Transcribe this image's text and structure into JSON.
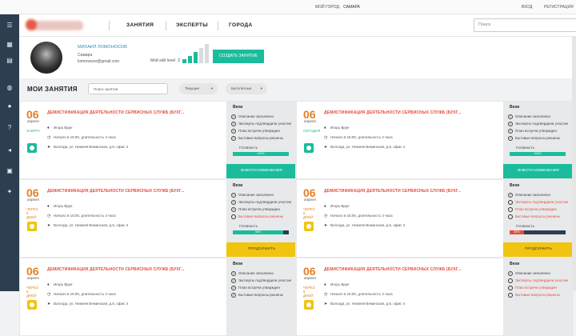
{
  "top": {
    "city_label": "МОЙ ГОРОД:",
    "city": "САМАРА",
    "login": "ВХОД",
    "register": "РЕГИСТРАЦИЯ"
  },
  "nav": {
    "items": [
      "ЗАНЯТИЯ",
      "ЭКСПЕРТЫ",
      "ГОРОДА"
    ],
    "search_placeholder": "Поиск",
    "search_icon": "search-icon"
  },
  "sidebar": {
    "icons": [
      "menu-icon",
      "home-icon",
      "calendar-icon",
      "globe-icon",
      "users-icon",
      "question-icon",
      "megaphone-icon",
      "briefcase-icon",
      "team-icon"
    ]
  },
  "profile": {
    "name": "МИХАИЛ ЛОМОНОСОВ",
    "city": "Самара",
    "email": "lomonosov@gmail.com",
    "skill_label": "Мой skill level",
    "skill_value": "3",
    "skill_level_fraction": 0.6,
    "create_button": "СОЗДАТЬ ЗАНЯТИЕ"
  },
  "toolbar": {
    "title": "МОИ ЗАНЯТИЯ",
    "search_placeholder": "Поиск занятия",
    "filter1": "Текущие",
    "filter2": "Бесплатные"
  },
  "cards": [
    {
      "day": "06",
      "month": "апреля",
      "when": "завтра",
      "title": "ДЕМИСТИФИКАЦИЯ ДЕЯТЕЛЬНОСТИ СЕРВИСНЫХ СЛУЖБ (БУХГ...",
      "person": "Игорь Вруе",
      "time": "Начало в 15:00, длительность 4 часа",
      "address": "Вологда, ул. Нижняя Вежинская, д.6, офис 4",
      "panel_title": "Вехи",
      "checks": [
        {
          "t": "Описание заполнено",
          "ok": true
        },
        {
          "t": "Эксперты подтвердили участие",
          "ok": true
        },
        {
          "t": "План встречи утвержден",
          "ok": true
        },
        {
          "t": "Бытовые вопросы решены",
          "ok": true
        }
      ],
      "ready_label": "Готовность",
      "progress_label": "100%",
      "progress": 100,
      "button": "ВНЕСТИ ИЗМЕНЕНИЯ",
      "status": "teal"
    },
    {
      "day": "06",
      "month": "апреля",
      "when": "сегодня",
      "title": "ДЕМИСТИФИКАЦИЯ ДЕЯТЕЛЬНОСТИ СЕРВИСНЫХ СЛУЖБ (БУХГ...",
      "person": "Игорь Вруе",
      "time": "Начало в 15:00, длительность 4 часа",
      "address": "Вологда, ул. Нижняя Вежинская, д.6, офис 4",
      "panel_title": "Вехи",
      "checks": [
        {
          "t": "Описание заполнено",
          "ok": true
        },
        {
          "t": "Эксперты подтвердили участие",
          "ok": true
        },
        {
          "t": "План встречи утвержден",
          "ok": true
        },
        {
          "t": "Бытовые вопросы решены",
          "ok": true
        }
      ],
      "ready_label": "Готовность",
      "progress_label": "100%",
      "progress": 100,
      "button": "ВНЕСТИ ИЗМЕНЕНИЯ",
      "status": "teal"
    },
    {
      "day": "06",
      "month": "апреля",
      "when": "через 5 дней",
      "title": "ДЕМИСТИФИКАЦИЯ ДЕЯТЕЛЬНОСТИ СЕРВИСНЫХ СЛУЖБ (БУХГ...",
      "person": "Игорь Вруе",
      "time": "Начало в 15:00, длительность 4 часа",
      "address": "Вологда, ул. Нижняя Вежинская, д.6, офис 4",
      "panel_title": "Вехи",
      "checks": [
        {
          "t": "Описание заполнено",
          "ok": true
        },
        {
          "t": "Эксперты подтвердили участие",
          "ok": true
        },
        {
          "t": "План встречи утвержден",
          "ok": true
        },
        {
          "t": "Бытовые вопросы решены",
          "ok": false
        }
      ],
      "ready_label": "Готовность",
      "progress_label": "90%",
      "progress": 90,
      "button": "ПРОДОЛЖИТЬ",
      "status": "yel"
    },
    {
      "day": "06",
      "month": "апреля",
      "when": "через 5 дней",
      "title": "ДЕМИСТИФИКАЦИЯ ДЕЯТЕЛЬНОСТИ СЕРВИСНЫХ СЛУЖБ (БУХГ...",
      "person": "Игорь Вруе",
      "time": "Начало в 15:00, длительность 4 часа",
      "address": "Вологда, ул. Нижняя Вежинская, д.6, офис 4",
      "panel_title": "Вехи",
      "checks": [
        {
          "t": "Описание заполнено",
          "ok": true
        },
        {
          "t": "Эксперты подтвердили участие",
          "ok": false
        },
        {
          "t": "План встречи утвержден",
          "ok": false
        },
        {
          "t": "Бытовые вопросы решены",
          "ok": false
        }
      ],
      "ready_label": "Готовность",
      "progress_label": "25%",
      "progress": 25,
      "button": "ПРОДОЛЖИТЬ",
      "status": "yel"
    },
    {
      "day": "06",
      "month": "апреля",
      "when": "через 5 дней",
      "title": "ДЕМИСТИФИКАЦИЯ ДЕЯТЕЛЬНОСТИ СЕРВИСНЫХ СЛУЖБ (БУХГ...",
      "person": "Игорь Вруе",
      "time": "Начало в 15:00, длительность 4 часа",
      "address": "Вологда, ул. Нижняя Вежинская, д.6, офис 4",
      "panel_title": "Вехи",
      "checks": [
        {
          "t": "Описание заполнено",
          "ok": true
        },
        {
          "t": "Эксперты подтвердили участие",
          "ok": true
        },
        {
          "t": "План встречи утвержден",
          "ok": true
        },
        {
          "t": "Бытовые вопросы решены",
          "ok": true
        }
      ],
      "ready_label": "",
      "progress_label": "",
      "button": "",
      "status": "yel"
    },
    {
      "day": "06",
      "month": "апреля",
      "when": "через 5 дней",
      "title": "ДЕМИСТИФИКАЦИЯ ДЕЯТЕЛЬНОСТИ СЕРВИСНЫХ СЛУЖБ (БУХГ...",
      "person": "Игорь Вруе",
      "time": "Начало в 15:00, длительность 4 часа",
      "address": "Вологда, ул. Нижняя Вежинская, д.6, офис 4",
      "panel_title": "Вехи",
      "checks": [
        {
          "t": "Описание заполнено",
          "ok": true
        },
        {
          "t": "Эксперты подтвердили участие",
          "ok": false
        },
        {
          "t": "План встречи утвержден",
          "ok": false
        },
        {
          "t": "Бытовые вопросы решены",
          "ok": false
        }
      ],
      "ready_label": "",
      "progress_label": "",
      "button": "",
      "status": "yel"
    }
  ]
}
